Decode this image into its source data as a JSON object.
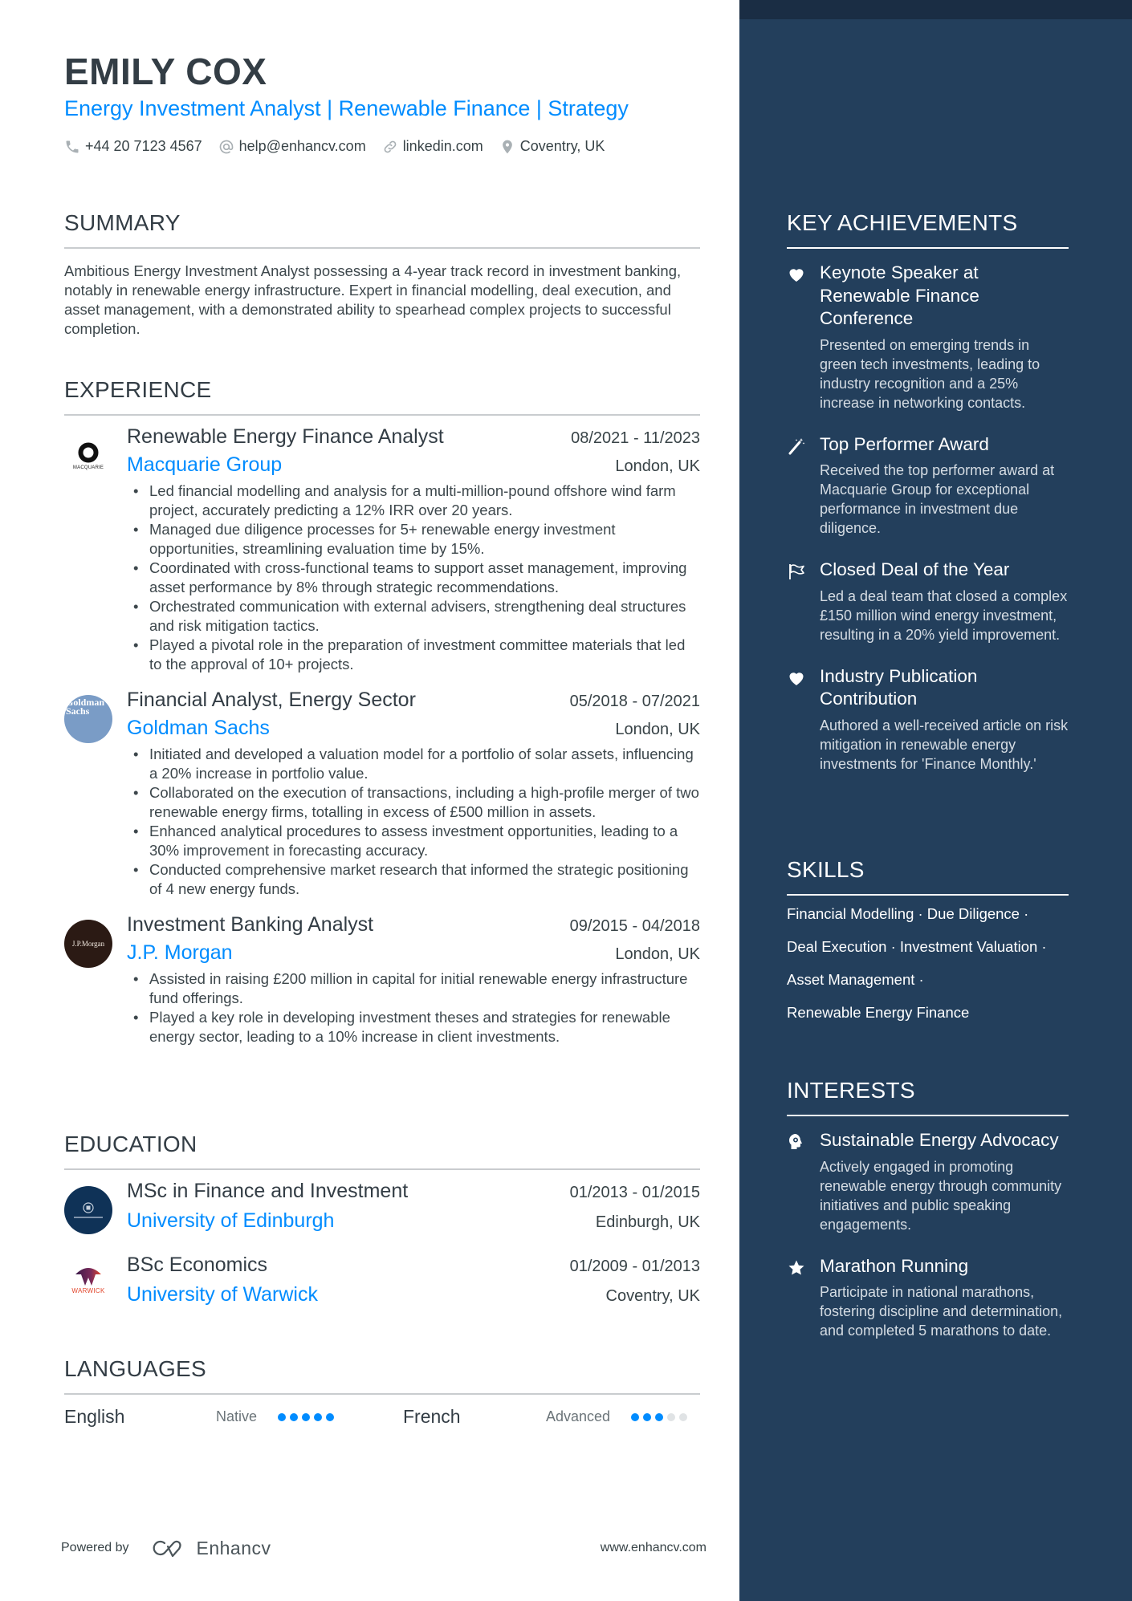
{
  "header": {
    "name": "EMILY COX",
    "headline": "Energy Investment Analyst | Renewable Finance | Strategy",
    "contacts": [
      {
        "icon": "phone-icon",
        "text": "+44 20 7123 4567"
      },
      {
        "icon": "at-icon",
        "text": "help@enhancv.com"
      },
      {
        "icon": "link-icon",
        "text": "linkedin.com"
      },
      {
        "icon": "location-pin-icon",
        "text": "Coventry, UK"
      }
    ]
  },
  "summary": {
    "title": "SUMMARY",
    "text": "Ambitious Energy Investment Analyst possessing a 4-year track record in investment banking, notably in renewable energy infrastructure. Expert in financial modelling, deal execution, and asset management, with a demonstrated ability to spearhead complex projects to successful completion."
  },
  "experience": {
    "title": "EXPERIENCE",
    "jobs": [
      {
        "role": "Renewable Energy Finance Analyst",
        "dates": "08/2021 - 11/2023",
        "company": "Macquarie Group",
        "location": "London, UK",
        "logo_text": "MACQUARIE",
        "bullets": [
          "Led financial modelling and analysis for a multi-million-pound offshore wind farm project, accurately predicting a 12% IRR over 20 years.",
          "Managed due diligence processes for 5+ renewable energy investment opportunities, streamlining evaluation time by 15%.",
          "Coordinated with cross-functional teams to support asset management, improving asset performance by 8% through strategic recommendations.",
          "Orchestrated communication with external advisers, strengthening deal structures and risk mitigation tactics.",
          "Played a pivotal role in the preparation of investment committee materials that led to the approval of 10+ projects."
        ]
      },
      {
        "role": "Financial Analyst, Energy Sector",
        "dates": "05/2018 - 07/2021",
        "company": "Goldman Sachs",
        "location": "London, UK",
        "logo_text": "Goldman Sachs",
        "bullets": [
          "Initiated and developed a valuation model for a portfolio of solar assets, influencing a 20% increase in portfolio value.",
          "Collaborated on the execution of transactions, including a high-profile merger of two renewable energy firms, totalling in excess of £500 million in assets.",
          "Enhanced analytical procedures to assess investment opportunities, leading to a 30% improvement in forecasting accuracy.",
          "Conducted comprehensive market research that informed the strategic positioning of 4 new energy funds."
        ]
      },
      {
        "role": "Investment Banking Analyst",
        "dates": "09/2015 - 04/2018",
        "company": "J.P. Morgan",
        "location": "London, UK",
        "logo_text": "J.P.Morgan",
        "bullets": [
          "Assisted in raising £200 million in capital for initial renewable energy infrastructure fund offerings.",
          "Played a key role in developing investment theses and strategies for renewable energy sector, leading to a 10% increase in client investments."
        ]
      }
    ]
  },
  "education": {
    "title": "EDUCATION",
    "items": [
      {
        "degree": "MSc in Finance and Investment",
        "dates": "01/2013 - 01/2015",
        "school": "University of Edinburgh",
        "location": "Edinburgh, UK"
      },
      {
        "degree": "BSc Economics",
        "dates": "01/2009 - 01/2013",
        "school": "University of Warwick",
        "location": "Coventry, UK",
        "logo_text": "WARWICK"
      }
    ]
  },
  "languages": {
    "title": "LANGUAGES",
    "items": [
      {
        "name": "English",
        "level": "Native",
        "rating": 5,
        "max": 5
      },
      {
        "name": "French",
        "level": "Advanced",
        "rating": 3,
        "max": 5
      }
    ]
  },
  "footer": {
    "powered_by": "Powered by",
    "brand": "Enhancv",
    "website": "www.enhancv.com"
  },
  "achievements": {
    "title": "KEY ACHIEVEMENTS",
    "items": [
      {
        "icon": "heart-icon",
        "title": "Keynote Speaker at Renewable Finance Conference",
        "desc": "Presented on emerging trends in green tech investments, leading to industry recognition and a 25% increase in networking contacts."
      },
      {
        "icon": "magic-wand-icon",
        "title": "Top Performer Award",
        "desc": "Received the top performer award at Macquarie Group for exceptional performance in investment due diligence."
      },
      {
        "icon": "flag-icon",
        "title": "Closed Deal of the Year",
        "desc": "Led a deal team that closed a complex £150 million wind energy investment, resulting in a 20% yield improvement."
      },
      {
        "icon": "heart-icon",
        "title": "Industry Publication Contribution",
        "desc": "Authored a well-received article on risk mitigation in renewable energy investments for 'Finance Monthly.'"
      }
    ]
  },
  "skills": {
    "title": "SKILLS",
    "lines": [
      "Financial Modelling · Due Diligence ·",
      "Deal Execution · Investment Valuation ·",
      "Asset Management ·",
      "Renewable Energy Finance"
    ]
  },
  "interests": {
    "title": "INTERESTS",
    "items": [
      {
        "icon": "head-brain-icon",
        "title": "Sustainable Energy Advocacy",
        "desc": "Actively engaged in promoting renewable energy through community initiatives and public speaking engagements."
      },
      {
        "icon": "star-icon",
        "title": "Marathon Running",
        "desc": "Participate in national marathons, fostering discipline and determination, and completed 5 marathons to date."
      }
    ]
  },
  "colors": {
    "accent": "#008cff",
    "sidebar": "#233f5c",
    "sidebar_top": "#1a2d44",
    "text": "#384347"
  }
}
